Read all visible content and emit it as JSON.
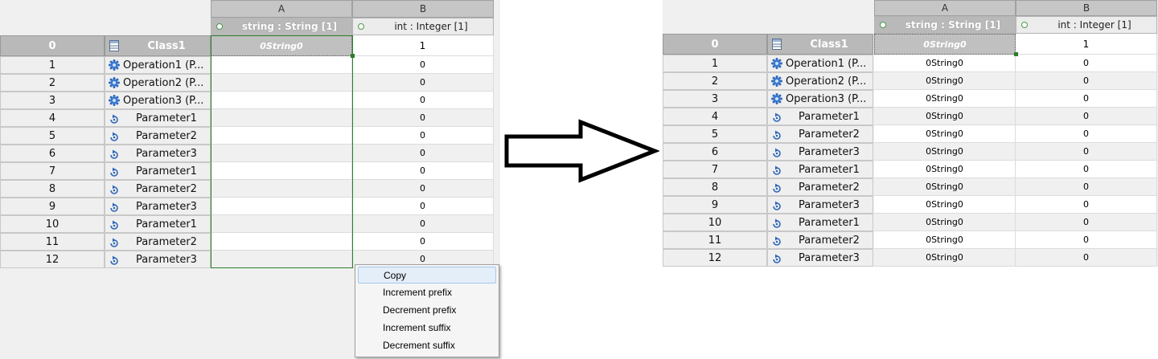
{
  "left": {
    "columns": [
      {
        "letter": "A",
        "header": "string : String [1]"
      },
      {
        "letter": "B",
        "header": "int : Integer [1]"
      }
    ],
    "header_row": {
      "num": "0",
      "name": "Class1",
      "a": "0String0",
      "b": "1"
    },
    "rows": [
      {
        "num": "1",
        "name": "Operation1 (P...",
        "kind": "operation",
        "a": "",
        "b": "0"
      },
      {
        "num": "2",
        "name": "Operation2 (P...",
        "kind": "operation",
        "a": "",
        "b": "0"
      },
      {
        "num": "3",
        "name": "Operation3 (P...",
        "kind": "operation",
        "a": "",
        "b": "0"
      },
      {
        "num": "4",
        "name": "Parameter1",
        "kind": "parameter",
        "a": "",
        "b": "0"
      },
      {
        "num": "5",
        "name": "Parameter2",
        "kind": "parameter",
        "a": "",
        "b": "0"
      },
      {
        "num": "6",
        "name": "Parameter3",
        "kind": "parameter",
        "a": "",
        "b": "0"
      },
      {
        "num": "7",
        "name": "Parameter1",
        "kind": "parameter",
        "a": "",
        "b": "0"
      },
      {
        "num": "8",
        "name": "Parameter2",
        "kind": "parameter",
        "a": "",
        "b": "0"
      },
      {
        "num": "9",
        "name": "Parameter3",
        "kind": "parameter",
        "a": "",
        "b": "0"
      },
      {
        "num": "10",
        "name": "Parameter1",
        "kind": "parameter",
        "a": "",
        "b": "0"
      },
      {
        "num": "11",
        "name": "Parameter2",
        "kind": "parameter",
        "a": "",
        "b": "0"
      },
      {
        "num": "12",
        "name": "Parameter3",
        "kind": "parameter",
        "a": "",
        "b": "0"
      }
    ],
    "context_menu": {
      "items": [
        "Copy",
        "Increment prefix",
        "Decrement prefix",
        "Increment suffix",
        "Decrement suffix"
      ],
      "highlighted": "Copy"
    }
  },
  "right": {
    "columns": [
      {
        "letter": "A",
        "header": "string : String [1]"
      },
      {
        "letter": "B",
        "header": "int : Integer [1]"
      }
    ],
    "header_row": {
      "num": "0",
      "name": "Class1",
      "a": "0String0",
      "b": "1"
    },
    "rows": [
      {
        "num": "1",
        "name": "Operation1 (P...",
        "kind": "operation",
        "a": "0String0",
        "b": "0"
      },
      {
        "num": "2",
        "name": "Operation2 (P...",
        "kind": "operation",
        "a": "0String0",
        "b": "0"
      },
      {
        "num": "3",
        "name": "Operation3 (P...",
        "kind": "operation",
        "a": "0String0",
        "b": "0"
      },
      {
        "num": "4",
        "name": "Parameter1",
        "kind": "parameter",
        "a": "0String0",
        "b": "0"
      },
      {
        "num": "5",
        "name": "Parameter2",
        "kind": "parameter",
        "a": "0String0",
        "b": "0"
      },
      {
        "num": "6",
        "name": "Parameter3",
        "kind": "parameter",
        "a": "0String0",
        "b": "0"
      },
      {
        "num": "7",
        "name": "Parameter1",
        "kind": "parameter",
        "a": "0String0",
        "b": "0"
      },
      {
        "num": "8",
        "name": "Parameter2",
        "kind": "parameter",
        "a": "0String0",
        "b": "0"
      },
      {
        "num": "9",
        "name": "Parameter3",
        "kind": "parameter",
        "a": "0String0",
        "b": "0"
      },
      {
        "num": "10",
        "name": "Parameter1",
        "kind": "parameter",
        "a": "0String0",
        "b": "0"
      },
      {
        "num": "11",
        "name": "Parameter2",
        "kind": "parameter",
        "a": "0String0",
        "b": "0"
      },
      {
        "num": "12",
        "name": "Parameter3",
        "kind": "parameter",
        "a": "0String0",
        "b": "0"
      }
    ]
  },
  "icons": {
    "class": "class-icon",
    "operation": "gear-icon",
    "parameter": "parameter-icon",
    "property": "property-dot-icon",
    "transition": "right-arrow-icon"
  },
  "colors": {
    "selection": "#2d7d2d",
    "header_gray": "#b9b9b9",
    "menu_highlight": "#e4eef9"
  }
}
